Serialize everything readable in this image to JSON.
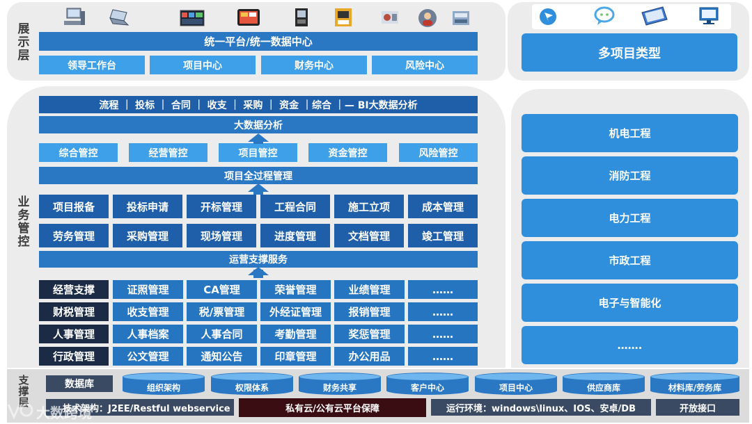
{
  "layers": {
    "display": "展示层",
    "business": "业务管控",
    "support": "支撑层"
  },
  "display": {
    "platform": "统一平台/统一数据中心",
    "centers": [
      "领导工作台",
      "项目中心",
      "财务中心",
      "风险中心"
    ],
    "icons": [
      "desktop-icon",
      "laptop-icon",
      "dashboard-screen-icon",
      "tablet-icon",
      "kiosk-icon",
      "terminal-icon",
      "camera-icon",
      "avatar-icon",
      "scanner-icon"
    ]
  },
  "right_top": {
    "title": "多项目类型",
    "icons": [
      "logo-icon",
      "chat-icon",
      "tablet-icon",
      "monitor-icon"
    ]
  },
  "business": {
    "process_bar": "流程 ｜ 投标 ｜ 合同 ｜ 收支 ｜ 采购 ｜ 资金 ｜综合 ｜— BI大数据分析",
    "bigdata": "大数据分析",
    "controls": [
      "综合管控",
      "经营管控",
      "项目管控",
      "资金管控",
      "风险管控"
    ],
    "full_process": "项目全过程管理",
    "modules_row1": [
      "项目报备",
      "投标申请",
      "开标管理",
      "工程合同",
      "施工立项",
      "成本管理"
    ],
    "modules_row2": [
      "劳务管理",
      "采购管理",
      "现场管理",
      "进度管理",
      "文档管理",
      "竣工管理"
    ],
    "ops_support": "运营支撑服务",
    "support_rows": [
      {
        "head": "经营支撑",
        "items": [
          "证照管理",
          "CA管理",
          "荣誉管理",
          "业绩管理",
          "……"
        ]
      },
      {
        "head": "财税管理",
        "items": [
          "收支管理",
          "税/票管理",
          "外经证管理",
          "报销管理",
          "……"
        ]
      },
      {
        "head": "人事管理",
        "items": [
          "人事档案",
          "人事合同",
          "考勤管理",
          "奖惩管理",
          "……"
        ]
      },
      {
        "head": "行政管理",
        "items": [
          "公文管理",
          "通知公告",
          "印章管理",
          "办公用品",
          "……"
        ]
      }
    ]
  },
  "project_types": [
    "机电工程",
    "消防工程",
    "电力工程",
    "市政工程",
    "电子与智能化",
    "……."
  ],
  "support": {
    "db_label": "数据库",
    "databases": [
      "组织架构",
      "权限体系",
      "财务共享",
      "客户中心",
      "项目中心",
      "供应商库",
      "材料库/劳务库"
    ],
    "tech": "技术架构：J2EE/Restful webservice",
    "cloud": "私有云/公有云平台保障",
    "env": "运行环境：windows\\linux、IOS、安卓/DB",
    "api": "开放接口"
  },
  "watermark": "大数跨境"
}
